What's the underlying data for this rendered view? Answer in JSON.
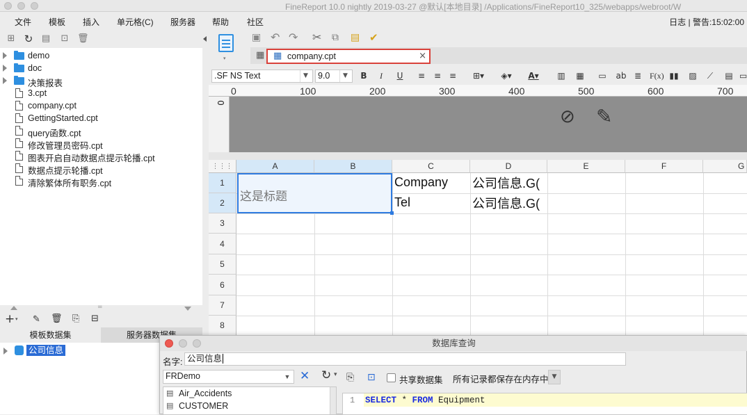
{
  "window": {
    "title": "FineReport 10.0 nightly 2019-03-27 @默认[本地目录]   /Applications/FineReport10_325/webapps/webroot/W"
  },
  "menu": {
    "items": [
      "文件",
      "模板",
      "插入",
      "单元格(C)",
      "服务器",
      "帮助",
      "社区"
    ],
    "status": "日志 | 警告:15:02:00"
  },
  "tree": {
    "items": [
      {
        "type": "folder",
        "label": "demo"
      },
      {
        "type": "folder",
        "label": "doc"
      },
      {
        "type": "folder",
        "label": "决策报表"
      },
      {
        "type": "file",
        "label": "3.cpt"
      },
      {
        "type": "file",
        "label": "company.cpt"
      },
      {
        "type": "file",
        "label": "GettingStarted.cpt"
      },
      {
        "type": "file",
        "label": "query函数.cpt"
      },
      {
        "type": "file",
        "label": "修改管理员密码.cpt"
      },
      {
        "type": "file",
        "label": "图表开启自动数据点提示轮播.cpt"
      },
      {
        "type": "file",
        "label": "数据点提示轮播.cpt"
      },
      {
        "type": "file",
        "label": "清除繁体所有职务.cpt"
      }
    ]
  },
  "dataset": {
    "tabs": [
      "模板数据集",
      "服务器数据集"
    ],
    "items": [
      "公司信息"
    ]
  },
  "editor": {
    "tab_label": "company.cpt",
    "font_name": ".SF NS Text",
    "font_size": "9.0",
    "bold": "B",
    "italic": "I",
    "underline": "U",
    "ruler_ticks": [
      "0",
      "100",
      "200",
      "300",
      "400",
      "500",
      "600",
      "700"
    ],
    "vruler_label": "0"
  },
  "sheet": {
    "columns": [
      "A",
      "B",
      "C",
      "D",
      "E",
      "F",
      "G"
    ],
    "rows": [
      "1",
      "2",
      "3",
      "4",
      "5",
      "6",
      "7",
      "8"
    ],
    "cells": {
      "a1": "这是标题",
      "c1": "Company",
      "c2": "Tel",
      "d1": "公司信息.G(",
      "d2": "公司信息.G("
    }
  },
  "dialog": {
    "title": "数据库查询",
    "name_label": "名字:",
    "name_value": "公司信息",
    "connection": "FRDemo",
    "tables": [
      "Air_Accidents",
      "CUSTOMER"
    ],
    "share_label": "共享数据集",
    "memory_option": "所有记录都保存在内存中",
    "sql_line_no": "1",
    "sql_kw1": "SELECT",
    "sql_star": " * ",
    "sql_kw2": "FROM",
    "sql_table": " Equipment"
  }
}
